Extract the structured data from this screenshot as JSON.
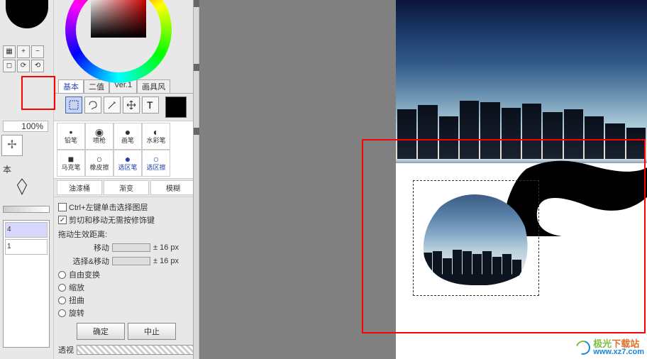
{
  "app": {
    "zoom": "100%"
  },
  "left_strip": {
    "btns": [
      "▦",
      "+",
      "−",
      "◻",
      "⟳",
      "⟲"
    ],
    "label": "本",
    "layers": [
      {
        "n": "4",
        "selected": true
      },
      {
        "n": "1",
        "selected": false
      }
    ]
  },
  "tabs": {
    "a": "基本",
    "b": "二值",
    "c": "Ver.1",
    "d": "画具风"
  },
  "tools_row1_names": [
    "select-rect-icon",
    "lasso-icon",
    "magic-wand-icon",
    "move-icon",
    "zoom-icon",
    "rotate-icon",
    "hand-icon",
    "eyedropper-icon"
  ],
  "tools_row2_names": [
    "pencil-icon",
    "airbrush-icon",
    "brush-icon",
    "watercolor-icon",
    "marker-icon",
    "eraser-icon",
    "select-pen-icon",
    "deselect-pen-icon"
  ],
  "brushes": {
    "r1": [
      {
        "label": "铅笔",
        "lnk": false
      },
      {
        "label": "喷枪",
        "lnk": false
      },
      {
        "label": "画笔",
        "lnk": false
      },
      {
        "label": "水彩笔",
        "lnk": false
      }
    ],
    "r2": [
      {
        "label": "马克笔",
        "lnk": false
      },
      {
        "label": "橡皮擦",
        "lnk": false
      },
      {
        "label": "选区笔",
        "lnk": true
      },
      {
        "label": "选区擦",
        "lnk": true
      }
    ],
    "wide": {
      "a": "油漆桶",
      "b": "渐变",
      "c": "模糊"
    }
  },
  "options": {
    "chk1": "Ctrl+左键单击选择图层",
    "chk2": "剪切和移动无需按修饰键",
    "heading": "拖动生效距离:",
    "move_label": "移动",
    "move_val": "± 16 px",
    "sel_move_label": "选择&移动",
    "sel_move_val": "± 16 px",
    "r1": "自由变换",
    "r2": "缩放",
    "r3": "扭曲",
    "r4": "旋转",
    "ok": "确定",
    "cancel": "中止",
    "opacity": "透视"
  },
  "watermark": {
    "cn_a": "极光",
    "cn_b": "下载站",
    "url": "www.xz7.com"
  }
}
